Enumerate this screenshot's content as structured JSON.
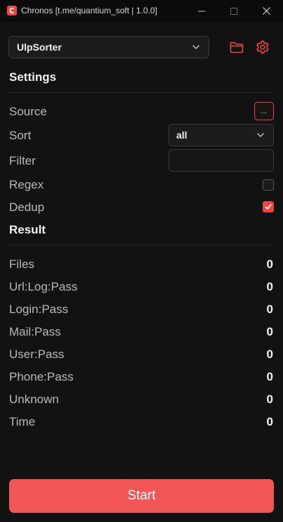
{
  "window": {
    "title": "Chronos [t.me/quantium_soft | 1.0.0]",
    "icons": [
      "app-icon",
      "minimize-icon",
      "maximize-icon",
      "close-icon"
    ]
  },
  "module": {
    "selected": "UlpSorter"
  },
  "toolbar": {
    "icons": [
      "folder-icon",
      "gear-icon"
    ]
  },
  "accent_color": "#ef4444",
  "settings": {
    "title": "Settings",
    "source_label": "Source",
    "source_button": "...",
    "sort_label": "Sort",
    "sort_value": "all",
    "filter_label": "Filter",
    "filter_value": "",
    "regex_label": "Regex",
    "regex_checked": false,
    "dedup_label": "Dedup",
    "dedup_checked": true
  },
  "result": {
    "title": "Result",
    "rows": [
      {
        "label": "Files",
        "value": "0"
      },
      {
        "label": "Url:Log:Pass",
        "value": "0"
      },
      {
        "label": "Login:Pass",
        "value": "0"
      },
      {
        "label": "Mail:Pass",
        "value": "0"
      },
      {
        "label": "User:Pass",
        "value": "0"
      },
      {
        "label": "Phone:Pass",
        "value": "0"
      },
      {
        "label": "Unknown",
        "value": "0"
      },
      {
        "label": "Time",
        "value": "0"
      }
    ]
  },
  "start_label": "Start"
}
